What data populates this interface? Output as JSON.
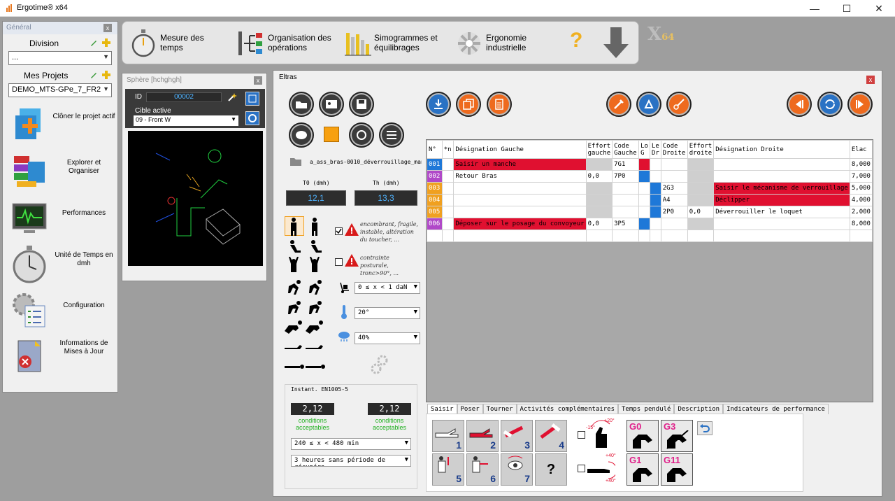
{
  "app": {
    "title": "Ergotime® x64"
  },
  "window_controls": {
    "minimize": "—",
    "maximize": "☐",
    "close": "✕"
  },
  "left_panel": {
    "header": "Général",
    "close": "x",
    "division_label": "Division",
    "division_value": "...",
    "projects_label": "Mes Projets",
    "project_value": "DEMO_MTS-GPe_7_FR2",
    "nav": [
      {
        "label": "Clôner le projet actif"
      },
      {
        "label": "Explorer et Organiser"
      },
      {
        "label": "Performances"
      },
      {
        "label": "Unité de Temps en dmh"
      },
      {
        "label": "Configuration"
      },
      {
        "label": "Informations de Mises à Jour"
      }
    ]
  },
  "toolbar": {
    "items": [
      {
        "label": "Mesure des temps"
      },
      {
        "label": "Organisation des opérations"
      },
      {
        "label": "Simogrammes et équilibrages"
      },
      {
        "label": "Ergonomie industrielle"
      }
    ],
    "help": "?",
    "logo_x": "X",
    "logo_64": "64"
  },
  "sphere": {
    "title": "Sphère [hchghgh]",
    "close": "x",
    "id_label": "ID",
    "id_value": "00002",
    "cible_label": "Cible active",
    "cible_value": "09 - Front W"
  },
  "eltras": {
    "title": "Eltras",
    "close": "x",
    "filename": "a_ass_bras-0010_déverrouillage_man",
    "t0_label": "T0 (dmh)",
    "t0_value": "12,1",
    "th_label": "Th (dmh)",
    "th_value": "13,3",
    "hint1": "encombrant, fragile, instable, altération du toucher, ...",
    "hint2": "contrainte posturale, tronc>90°, ...",
    "weight": "0 ≤ x < 1 daN",
    "temp": "20°",
    "humidity": "40%",
    "instant": {
      "title": "Instant. EN1005-5",
      "v1": "2,12",
      "v2": "2,12",
      "c1": "conditions acceptables",
      "c2": "conditions acceptables",
      "duration": "240 ≤ x < 480 min",
      "recovery": "3 heures sans période de récupéra"
    },
    "grid": {
      "headers": [
        "N°",
        "*n",
        "Désignation Gauche",
        "Effort gauche",
        "Code Gauche",
        "Lo G",
        "Le Dr",
        "Code Droite",
        "Effort droite",
        "Désignation Droite",
        "Elac"
      ],
      "rows": [
        {
          "n": "001",
          "ncolor": "#1e78d8",
          "dg": "Saisir un manche",
          "dgred": true,
          "eg": "",
          "cg": "7G1",
          "lg": "#e01030",
          "ld": "",
          "cd": "",
          "ed": "",
          "dd": "",
          "ddred": false,
          "el": "8,000"
        },
        {
          "n": "002",
          "ncolor": "#b048c8",
          "dg": "Retour Bras",
          "dgred": false,
          "eg": "0,0",
          "cg": "7P0",
          "lg": "#1e78d8",
          "ld": "",
          "cd": "",
          "ed": "",
          "dd": "",
          "ddred": false,
          "el": "7,000"
        },
        {
          "n": "003",
          "ncolor": "#f0a020",
          "dg": "",
          "dgred": false,
          "eg": "",
          "cg": "",
          "lg": "",
          "ld": "#1e78d8",
          "cd": "2G3",
          "ed": "",
          "dd": "Saisir le mécanisme de verrouillage",
          "ddred": true,
          "el": "5,000"
        },
        {
          "n": "004",
          "ncolor": "#f0a020",
          "dg": "",
          "dgred": false,
          "eg": "",
          "cg": "",
          "lg": "",
          "ld": "#1e78d8",
          "cd": "A4",
          "ed": "",
          "dd": "Déclipper",
          "ddred": true,
          "el": "4,000"
        },
        {
          "n": "005",
          "ncolor": "#f0a020",
          "dg": "",
          "dgred": false,
          "eg": "",
          "cg": "",
          "lg": "",
          "ld": "#1e78d8",
          "cd": "2P0",
          "ed": "0,0",
          "dd": "Déverrouiller le loquet",
          "ddred": false,
          "el": "2,000"
        },
        {
          "n": "006",
          "ncolor": "#b048c8",
          "dg": "Déposer sur le posage du convoyeur",
          "dgred": true,
          "eg": "0,0",
          "cg": "3P5",
          "lg": "#1e78d8",
          "ld": "",
          "cd": "",
          "ed": "",
          "dd": "",
          "ddred": false,
          "el": "8,000"
        }
      ]
    },
    "tabs": [
      "Saisir",
      "Poser",
      "Tourner",
      "Activités complémentaires",
      "Temps pendulé",
      "Description",
      "Indicateurs de performance"
    ],
    "grasp": {
      "numbers": [
        "1",
        "2",
        "3",
        "4",
        "5",
        "6",
        "7"
      ],
      "question": "?",
      "g_codes": [
        "G0",
        "G3",
        "G1",
        "G11"
      ],
      "angle1a": "+20°",
      "angle1b": "-15°",
      "angle2a": "+40°",
      "angle2b": "+40°"
    }
  },
  "colors": {
    "red": "#e01030",
    "blue": "#1e78d8",
    "orange": "#f0a020",
    "purple": "#b048c8"
  }
}
